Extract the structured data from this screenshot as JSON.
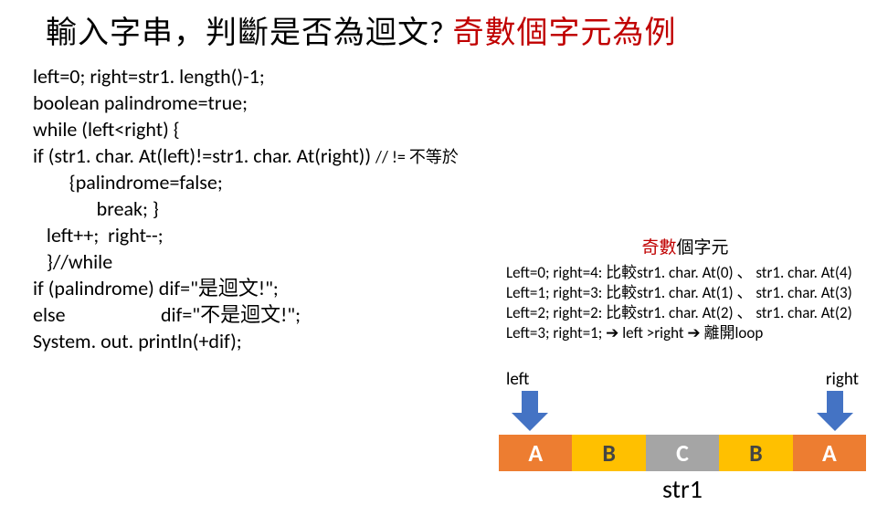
{
  "title": {
    "black": "輸入字串，判斷是否為迴文? ",
    "red": "奇數個字元為例"
  },
  "code": {
    "l1": "left=0; right=str1. length()-1;",
    "l2a": "boolean palindrome=",
    "l2b": "true",
    "l2c": ";",
    "l3": "while (left<right) {",
    "l4a": "   if (str1. char. At(left)!=str1. char. At(right)) ",
    "l4b": "  // !=  不等於",
    "l5": "        {palindrome=false;",
    "l6": "              break; }",
    "l7": "   left++;  right--;",
    "l8": "   }//while",
    "l9": "if (palindrome)  dif=\"是迴文!\";",
    "l10": "else                     dif=\"不是迴文!\";",
    "l11": "System. out. println(+dif);"
  },
  "side": {
    "odd_red": "奇數",
    "odd_rest": "個字元",
    "row1": "Left=0; right=4: 比較str1. char. At(0) 、 str1. char. At(4)",
    "row2": "Left=1; right=3: 比較str1. char. At(1) 、 str1. char. At(3)",
    "row3": "Left=2; right=2: 比較str1. char. At(2) 、 str1. char. At(2)",
    "row4a": "Left=3; right=1; ",
    "row4b": "➔",
    "row4c": " left >right ",
    "row4d": "➔",
    "row4e": " 離開loop"
  },
  "diagram": {
    "left_label": "left",
    "right_label": "right",
    "cells": [
      "A",
      "B",
      "C",
      "B",
      "A"
    ],
    "str_label": "str1"
  }
}
